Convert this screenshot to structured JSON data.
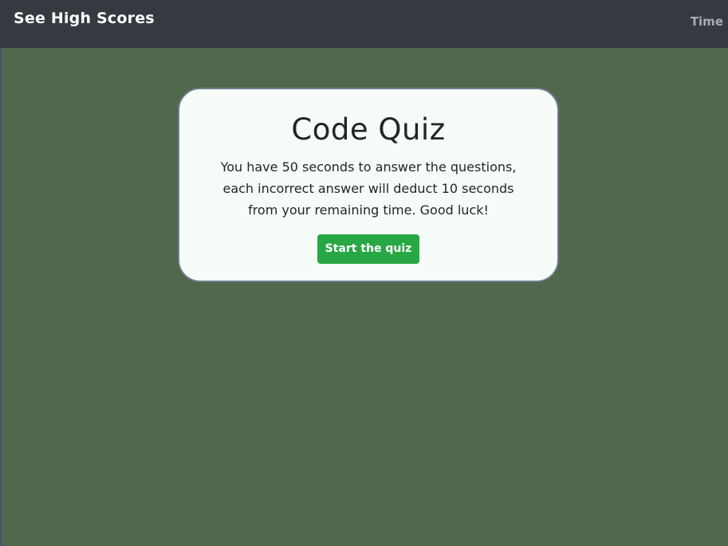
{
  "navbar": {
    "high_scores_link": "See High Scores",
    "timer_label": "Time"
  },
  "quiz_card": {
    "title": "Code Quiz",
    "intro_line_1": "You have 50 seconds to answer the questions,",
    "intro_line_2": "each incorrect answer will deduct 10 seconds",
    "intro_line_3": "from your remaining time. Good luck!",
    "start_button_label": "Start the quiz"
  },
  "colors": {
    "page_background": "#51684d",
    "navbar_background": "#343a40",
    "card_background": "#f7fcf9",
    "start_button": "#28a745"
  }
}
